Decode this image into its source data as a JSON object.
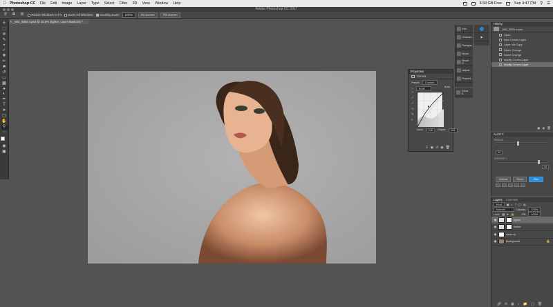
{
  "menubar": {
    "app_name": "Photoshop CC",
    "items": [
      "File",
      "Edit",
      "Image",
      "Layer",
      "Type",
      "Select",
      "Filter",
      "3D",
      "View",
      "Window",
      "Help"
    ],
    "free_space": "8.58 GB Free",
    "clock": "Sun 4:47 PM"
  },
  "window": {
    "title": "Adobe Photoshop CC 2017"
  },
  "options_bar": {
    "resize_windows_label": "Resize Windows to Fit",
    "zoom_all_label": "Zoom All Windows",
    "scrubby_zoom_label": "Scrubby Zoom",
    "zoom_value": "100%",
    "fit_screen_label": "Fit Screen",
    "fill_screen_label": "Fill Screen"
  },
  "document": {
    "tab_title": "_MG_0084 4.psd @ 23.6% (lighter, Layer Mask/16) *"
  },
  "properties": {
    "title": "Properties",
    "adjustment": "Curves",
    "preset_label": "Preset:",
    "preset_value": "Custom",
    "channel_value": "RGB",
    "auto_label": "Auto",
    "input_label": "Input:",
    "input_value": "106",
    "output_label": "Output:",
    "output_value": "151"
  },
  "dock": {
    "info": "Info",
    "characters": "Charact...",
    "paragraph": "Paragra...",
    "brush": "Brush",
    "brush_presets": "Brush P...",
    "adjustments": "Adjust...",
    "properties": "Propert...",
    "clone_source": "Clone S..."
  },
  "history": {
    "title": "History",
    "snapshot": "_MG_0084 4.psd",
    "items": [
      "Open",
      "New Curves Layer",
      "Layer Via Copy",
      "Name Change",
      "Name Change",
      "Modify Curves Layer",
      "Modify Curves Layer"
    ]
  },
  "plugin": {
    "title": "ALCE 3",
    "radius_label": "RADIUS",
    "radius_value": "30",
    "intensity_label": "INTENSITY",
    "intensity_value": "18",
    "actions_label": "Actions",
    "reset_label": "Reset",
    "run_label": "Run"
  },
  "layers": {
    "tab_layers": "Layers",
    "tab_channels": "Channels",
    "kind_label": "Kind",
    "blend_mode": "Normal",
    "opacity_label": "Opacity:",
    "opacity_value": "100%",
    "lock_label": "Lock:",
    "fill_label": "Fill:",
    "fill_value": "100%",
    "rows": [
      "lighter",
      "darker",
      "clean up",
      "Background"
    ]
  },
  "colors": {
    "run_button": "#2d8bd8",
    "canvas_bg": "#535353",
    "photo_bg": "#a8a8a8"
  }
}
